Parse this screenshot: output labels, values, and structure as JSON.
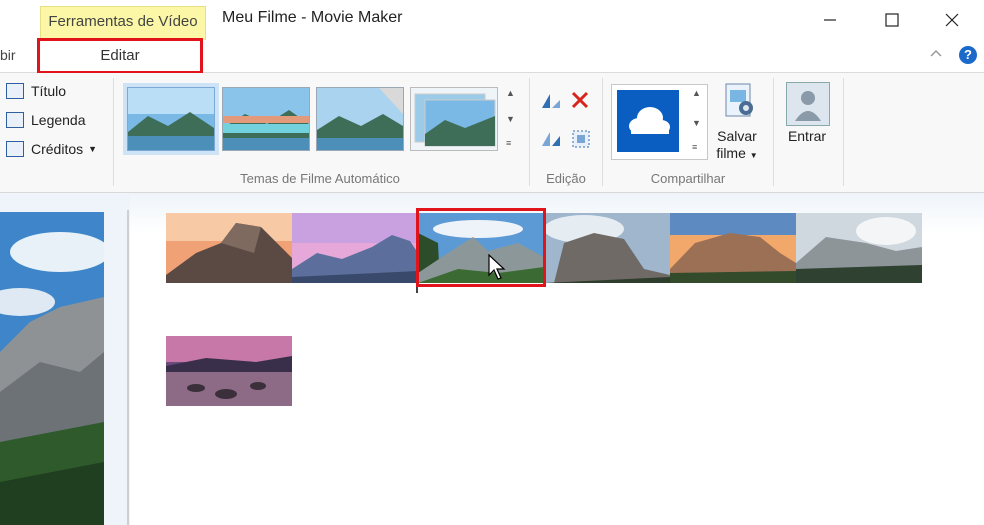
{
  "window": {
    "contextual_tab": "Ferramentas de Vídeo",
    "title": "Meu Filme - Movie Maker"
  },
  "tabs": {
    "partial_left": "bir",
    "active": "Editar"
  },
  "ribbon": {
    "text_items": [
      "Título",
      "Legenda",
      "Créditos"
    ],
    "groups": {
      "themes": "Temas de Filme Automático",
      "edit": "Edição",
      "share": "Compartilhar"
    },
    "save_movie": [
      "Salvar",
      "filme"
    ],
    "sign_in": "Entrar"
  },
  "storyboard": {
    "clips_row1": [
      "half-dome-sunset",
      "valley-pink-sky",
      "yosemite-valley-selected",
      "el-capitan-fog",
      "el-capitan-sunset",
      "valley-misty"
    ],
    "clips_row2": [
      "lake-rocks-sunset"
    ]
  },
  "colors": {
    "highlight": "#e0141a",
    "contextual_tab": "#fbf7a6",
    "onedrive": "#0a5ec1"
  }
}
